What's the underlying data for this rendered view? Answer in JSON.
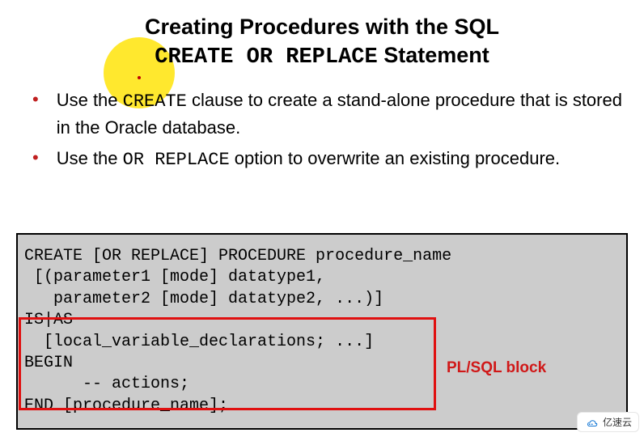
{
  "title": {
    "line1": "Creating Procedures with the SQL",
    "code": "CREATE OR REPLACE",
    "line2_suffix": " Statement"
  },
  "bullets": [
    {
      "pre": "Use the ",
      "code": "CREATE",
      "post": " clause to create a stand-alone procedure that is stored in the Oracle database."
    },
    {
      "pre": "Use the ",
      "code": "OR REPLACE",
      "post": " option to overwrite an existing procedure."
    }
  ],
  "code_block": {
    "line1": "CREATE [OR REPLACE] PROCEDURE procedure_name",
    "line2": " [(parameter1 [mode] datatype1,",
    "line3": "   parameter2 [mode] datatype2, ...)]",
    "line4": "IS|AS",
    "line5": "  [local_variable_declarations; ...]",
    "line6": "BEGIN",
    "line7": "      -- actions;",
    "line8": "END [procedure_name];"
  },
  "annotation": {
    "plsql_block": "PL/SQL block"
  },
  "watermark": {
    "text": "亿速云"
  }
}
